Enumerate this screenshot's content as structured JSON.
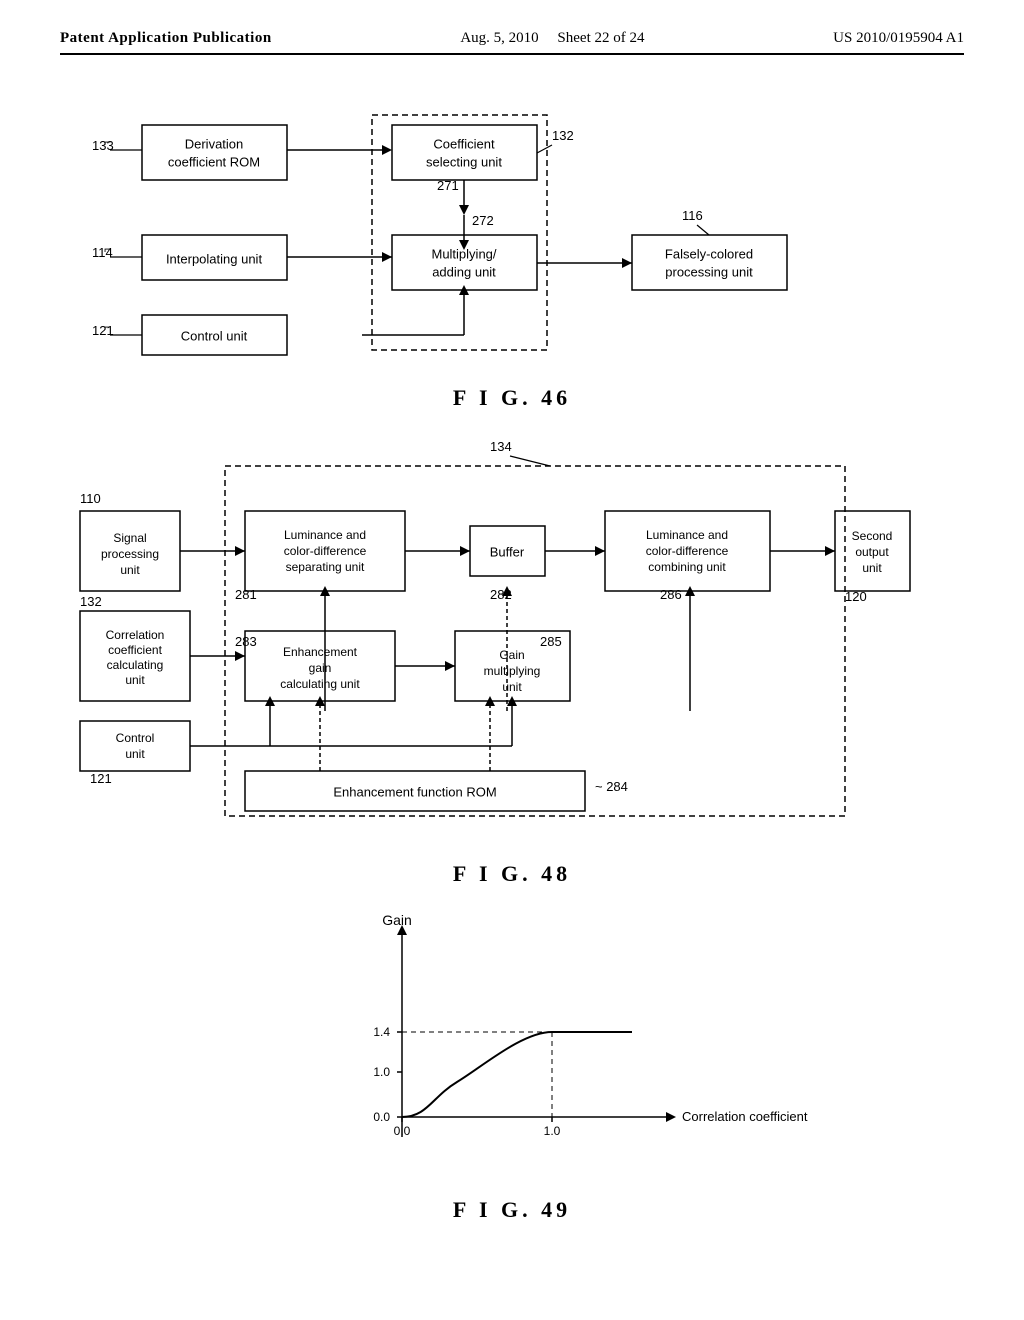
{
  "header": {
    "left": "Patent Application Publication",
    "center": "Aug. 5, 2010",
    "sheet": "Sheet 22 of 24",
    "right": "US 2010/0195904 A1"
  },
  "fig46": {
    "label": "F I G. 46",
    "nodes": {
      "derivation_rom": "Derivation\ncoefficient ROM",
      "coeff_select": "Coefficient\nselecting unit",
      "interpolating": "Interpolating unit",
      "multiply_add": "Multiplying/\nadding unit",
      "control": "Control unit",
      "falsely_colored": "Falsely-colored\nprocessing unit"
    },
    "labels": {
      "n133": "133",
      "n114": "114",
      "n121": "121",
      "n132": "132",
      "n116": "116",
      "n271": "271",
      "n272": "272"
    }
  },
  "fig48": {
    "label": "F I G. 48",
    "nodes": {
      "signal_proc": "Signal\nprocessing\nunit",
      "lum_sep": "Luminance and\ncolor-difference\nseparating unit",
      "buffer": "Buffer",
      "lum_comb": "Luminance and\ncolor-difference\ncombining unit",
      "second_out": "Second\noutput\nunit",
      "corr_coeff": "Correlation\ncoefficient\ncalculating\nunit",
      "control": "Control\nunit",
      "enhance_gain": "Enhancement\ngain\ncalculating unit",
      "gain_mult": "Gain\nmultiplying\nunit",
      "enhance_rom": "Enhancement function ROM"
    },
    "labels": {
      "n110": "110",
      "n132": "132",
      "n121": "121",
      "n120": "120",
      "n134": "134",
      "n281": "281",
      "n282": "282",
      "n283": "283",
      "n284": "284",
      "n285": "285",
      "n286": "286"
    }
  },
  "fig49": {
    "label": "F I G. 49",
    "axis_y": "Gain",
    "axis_x": "Correlation coefficient",
    "y_values": [
      "1.4",
      "1.0",
      "0.0"
    ],
    "x_values": [
      "0.0",
      "1.0"
    ]
  }
}
